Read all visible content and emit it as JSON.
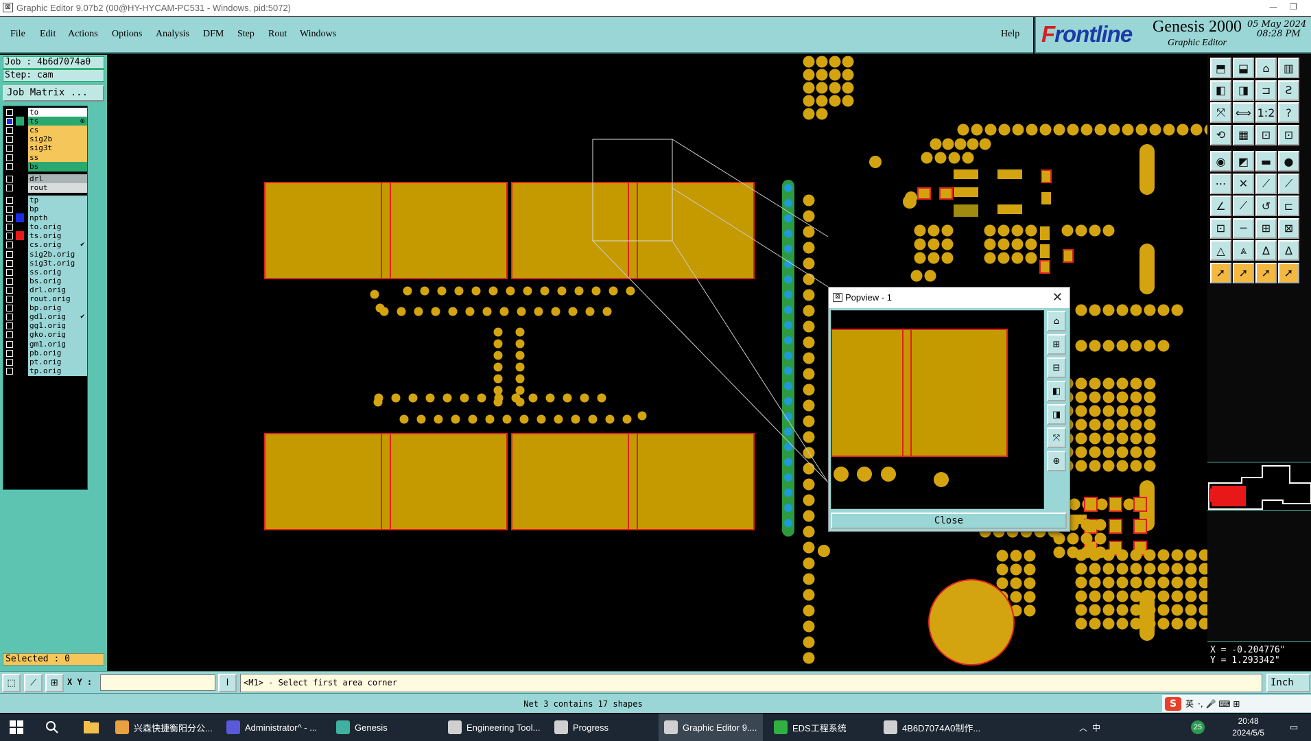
{
  "window": {
    "title": "Graphic Editor 9.07b2 (00@HY-HYCAM-PC531 - Windows, pid:5072)",
    "restore_glyph": "❐",
    "min_glyph": "—"
  },
  "menu": {
    "items": [
      "File",
      "Edit",
      "Actions",
      "Options",
      "Analysis",
      "DFM",
      "Step",
      "Rout",
      "Windows"
    ],
    "help": "Help"
  },
  "logo": {
    "brand_f": "F",
    "brand_rest": "rontline",
    "product": "Genesis 2000",
    "subtitle": "Graphic Editor",
    "date": "05 May 2024",
    "time": "08:28 PM"
  },
  "job": {
    "job": "Job : 4b6d7074a0",
    "step": "Step: cam",
    "job_matrix": "Job Matrix ..."
  },
  "layers": [
    {
      "name": "to",
      "color": "#ffffff",
      "swatch": "#000000",
      "checked": false
    },
    {
      "name": "ts",
      "color": "#2aa870",
      "swatch": "#2aa870",
      "checked": true,
      "mark": "⊕"
    },
    {
      "name": "cs",
      "color": "#f5c65a",
      "swatch": "#000000",
      "checked": false
    },
    {
      "name": "sig2b",
      "color": "#f5c65a",
      "swatch": "#000000",
      "checked": false
    },
    {
      "name": "sig3t",
      "color": "#f5c65a",
      "swatch": "#000000",
      "checked": false
    },
    {
      "name": "ss",
      "color": "#f5c65a",
      "swatch": "#000000",
      "checked": false
    },
    {
      "name": "bs",
      "color": "#2aa870",
      "swatch": "#000000",
      "checked": false
    },
    {
      "name": "drl",
      "color": "#a8b4b4",
      "swatch": "#000000",
      "checked": false,
      "gap": true
    },
    {
      "name": "rout",
      "color": "#d8dcdc",
      "swatch": "#000000",
      "checked": false
    },
    {
      "name": "tp",
      "color": "#9bd6d6",
      "swatch": "#000000",
      "checked": false,
      "gap": true
    },
    {
      "name": "bp",
      "color": "#9bd6d6",
      "swatch": "#000000",
      "checked": false
    },
    {
      "name": "npth",
      "color": "#9bd6d6",
      "swatch": "#1a2ce8",
      "checked": false
    },
    {
      "name": "to.orig",
      "color": "#9bd6d6",
      "swatch": "#000000",
      "checked": false
    },
    {
      "name": "ts.orig",
      "color": "#9bd6d6",
      "swatch": "#e81818",
      "checked": false
    },
    {
      "name": "cs.orig",
      "color": "#9bd6d6",
      "swatch": "#000000",
      "checked": false,
      "mark": "✔"
    },
    {
      "name": "sig2b.orig",
      "color": "#9bd6d6",
      "swatch": "#000000",
      "checked": false
    },
    {
      "name": "sig3t.orig",
      "color": "#9bd6d6",
      "swatch": "#000000",
      "checked": false
    },
    {
      "name": "ss.orig",
      "color": "#9bd6d6",
      "swatch": "#000000",
      "checked": false
    },
    {
      "name": "bs.orig",
      "color": "#9bd6d6",
      "swatch": "#000000",
      "checked": false
    },
    {
      "name": "drl.orig",
      "color": "#9bd6d6",
      "swatch": "#000000",
      "checked": false
    },
    {
      "name": "rout.orig",
      "color": "#9bd6d6",
      "swatch": "#000000",
      "checked": false
    },
    {
      "name": "bp.orig",
      "color": "#9bd6d6",
      "swatch": "#000000",
      "checked": false
    },
    {
      "name": "gd1.orig",
      "color": "#9bd6d6",
      "swatch": "#000000",
      "checked": false,
      "mark": "✔"
    },
    {
      "name": "gg1.orig",
      "color": "#9bd6d6",
      "swatch": "#000000",
      "checked": false
    },
    {
      "name": "gko.orig",
      "color": "#9bd6d6",
      "swatch": "#000000",
      "checked": false
    },
    {
      "name": "gm1.orig",
      "color": "#9bd6d6",
      "swatch": "#000000",
      "checked": false
    },
    {
      "name": "pb.orig",
      "color": "#9bd6d6",
      "swatch": "#000000",
      "checked": false
    },
    {
      "name": "pt.orig",
      "color": "#9bd6d6",
      "swatch": "#000000",
      "checked": false
    },
    {
      "name": "tp.orig",
      "color": "#9bd6d6",
      "swatch": "#000000",
      "checked": false
    }
  ],
  "selected": "Selected : 0",
  "status": {
    "xy_label": "X Y :",
    "xy_value": "",
    "prompt": "<M1> - Select first area corner",
    "unit": "Inch",
    "net_message": "Net 3 contains 17 shapes",
    "xy_glyph": "Ⅰ"
  },
  "coords": {
    "x": "X = -0.204776\"",
    "y": "Y =  1.293342\""
  },
  "popview": {
    "title": "Popview - 1",
    "close_button": "Close",
    "close_glyph": "✕"
  },
  "ime": {
    "logo": "S",
    "lang": "英",
    "extra": "·, 🎤 ⌨ ⊞"
  },
  "taskbar": {
    "items": [
      {
        "label": "兴森快捷衡阳分公...",
        "icon": "#e8a040"
      },
      {
        "label": "Administrator^ - ...",
        "icon": "#5a5ad8"
      },
      {
        "label": "Genesis",
        "icon": "#40b0a0"
      },
      {
        "label": "Engineering Tool...",
        "icon": "#d0d0d0"
      },
      {
        "label": "Progress",
        "icon": "#d0d0d0"
      },
      {
        "label": "Graphic Editor 9....",
        "icon": "#d0d0d0",
        "active": true
      },
      {
        "label": "EDS工程系统",
        "icon": "#30b040"
      },
      {
        "label": "4B6D7074A0制作...",
        "icon": "#d0d0d0"
      }
    ],
    "time": "20:48",
    "date": "2024/5/5",
    "tray_lang": "中",
    "tray_badge": "25"
  },
  "colors": {
    "copper": "#c49a00",
    "outline": "#e02020",
    "panel": "#9bd6d6",
    "pad": "#d4a410"
  }
}
